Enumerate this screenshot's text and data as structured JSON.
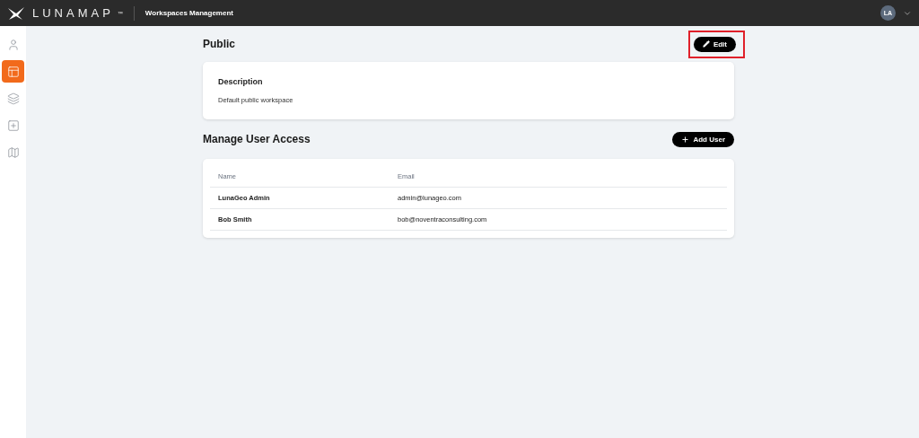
{
  "header": {
    "logo": "LUNAMAP",
    "trademark": "™",
    "title": "Workspaces Management",
    "avatar": "LA"
  },
  "sidebar": {
    "items": [
      {
        "selected": false
      },
      {
        "selected": true
      },
      {
        "selected": false
      },
      {
        "selected": false
      },
      {
        "selected": false
      }
    ]
  },
  "workspace": {
    "title": "Public",
    "edit_button": {
      "label": "Edit",
      "highlighted": true
    },
    "description_label": "Description",
    "description": "Default public workspace"
  },
  "access": {
    "title": "Manage User Access",
    "add_button": "Add User",
    "columns": [
      "Name",
      "Email"
    ],
    "rows": [
      {
        "name": "LunaGeo Admin",
        "email": "admin@lunageo.com"
      },
      {
        "name": "Bob Smith",
        "email": "bob@noventraconsulting.com"
      }
    ]
  }
}
